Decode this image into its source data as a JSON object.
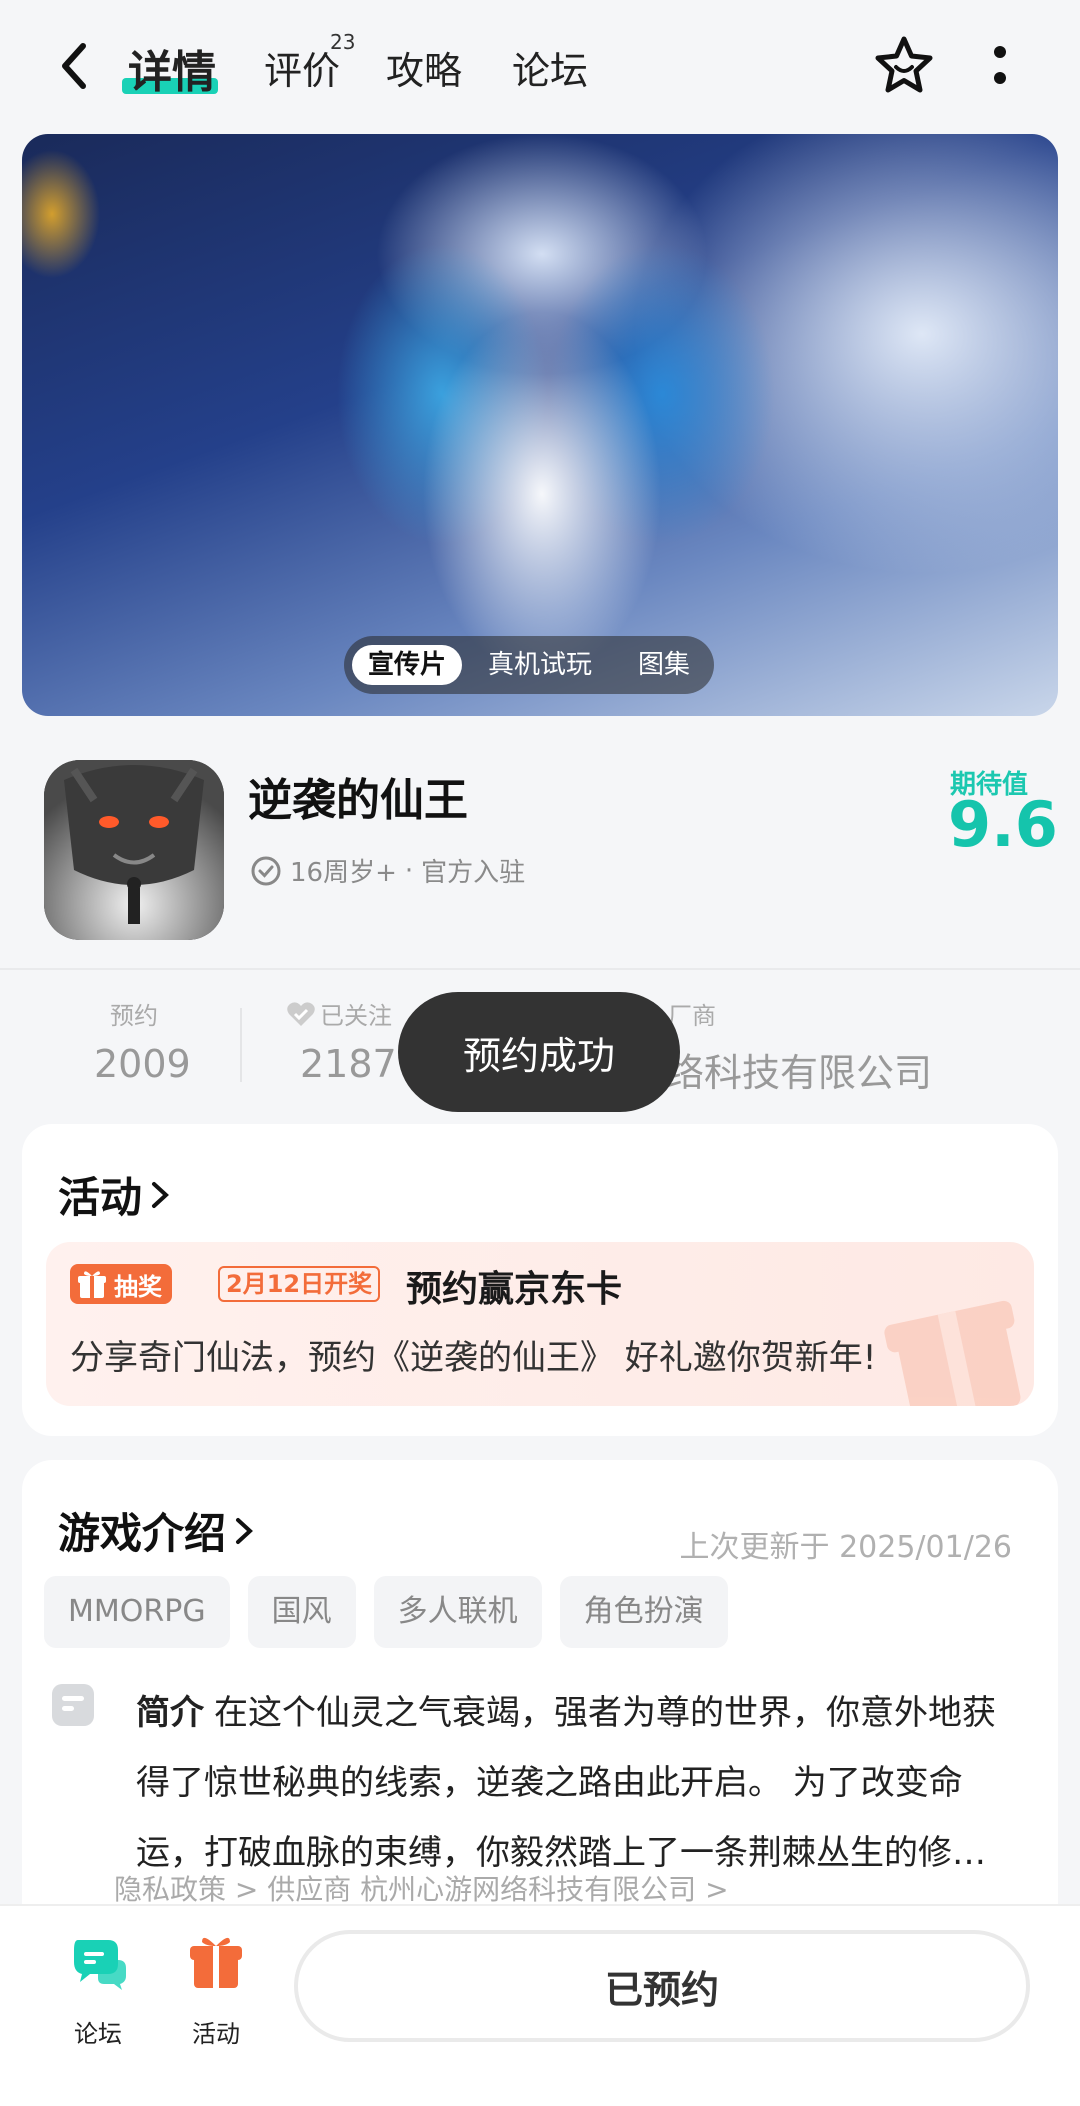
{
  "header": {
    "tabs": [
      {
        "label": "详情",
        "active": true
      },
      {
        "label": "评价",
        "badge": "23"
      },
      {
        "label": "攻略"
      },
      {
        "label": "论坛"
      }
    ]
  },
  "hero": {
    "media_tabs": [
      "宣传片",
      "真机试玩",
      "图集"
    ]
  },
  "game": {
    "title": "逆袭的仙王",
    "age": "16周岁+",
    "dot": "·",
    "official": "官方入驻",
    "rating_label": "期待值",
    "rating_value": "9.6"
  },
  "stats": {
    "reserve_label": "预约",
    "reserve_value": "2009",
    "follow_label": "已关注",
    "follow_value": "2187",
    "vendor_label": "厂商",
    "vendor_value": "络科技有限公司"
  },
  "toast": "预约成功",
  "activity": {
    "title": "活动",
    "tag": "抽奖",
    "date": "2月12日开奖",
    "promo_title": "预约赢京东卡",
    "promo_desc": "分享奇门仙法，预约《逆袭的仙王》 好礼邀你贺新年!"
  },
  "intro": {
    "title": "游戏介绍",
    "updated": "上次更新于 2025/01/26",
    "tags": [
      "MMORPG",
      "国风",
      "多人联机",
      "角色扮演"
    ],
    "label": "简介",
    "text": "在这个仙灵之气衰竭，强者为尊的世界，你意外地获得了惊世秘典的线索，逆袭之路由此开启。 为了改变命运，打破血脉的束缚，你毅然踏上了一条荆棘丛生的修仙之路……",
    "extra": "隐私政策 >   供应商 杭州心游网络科技有限公司 >"
  },
  "bottom": {
    "forum_label": "论坛",
    "activity_label": "活动",
    "reserve_btn": "已预约"
  },
  "colors": {
    "accent": "#19d1b6",
    "orange": "#f36c3a"
  }
}
